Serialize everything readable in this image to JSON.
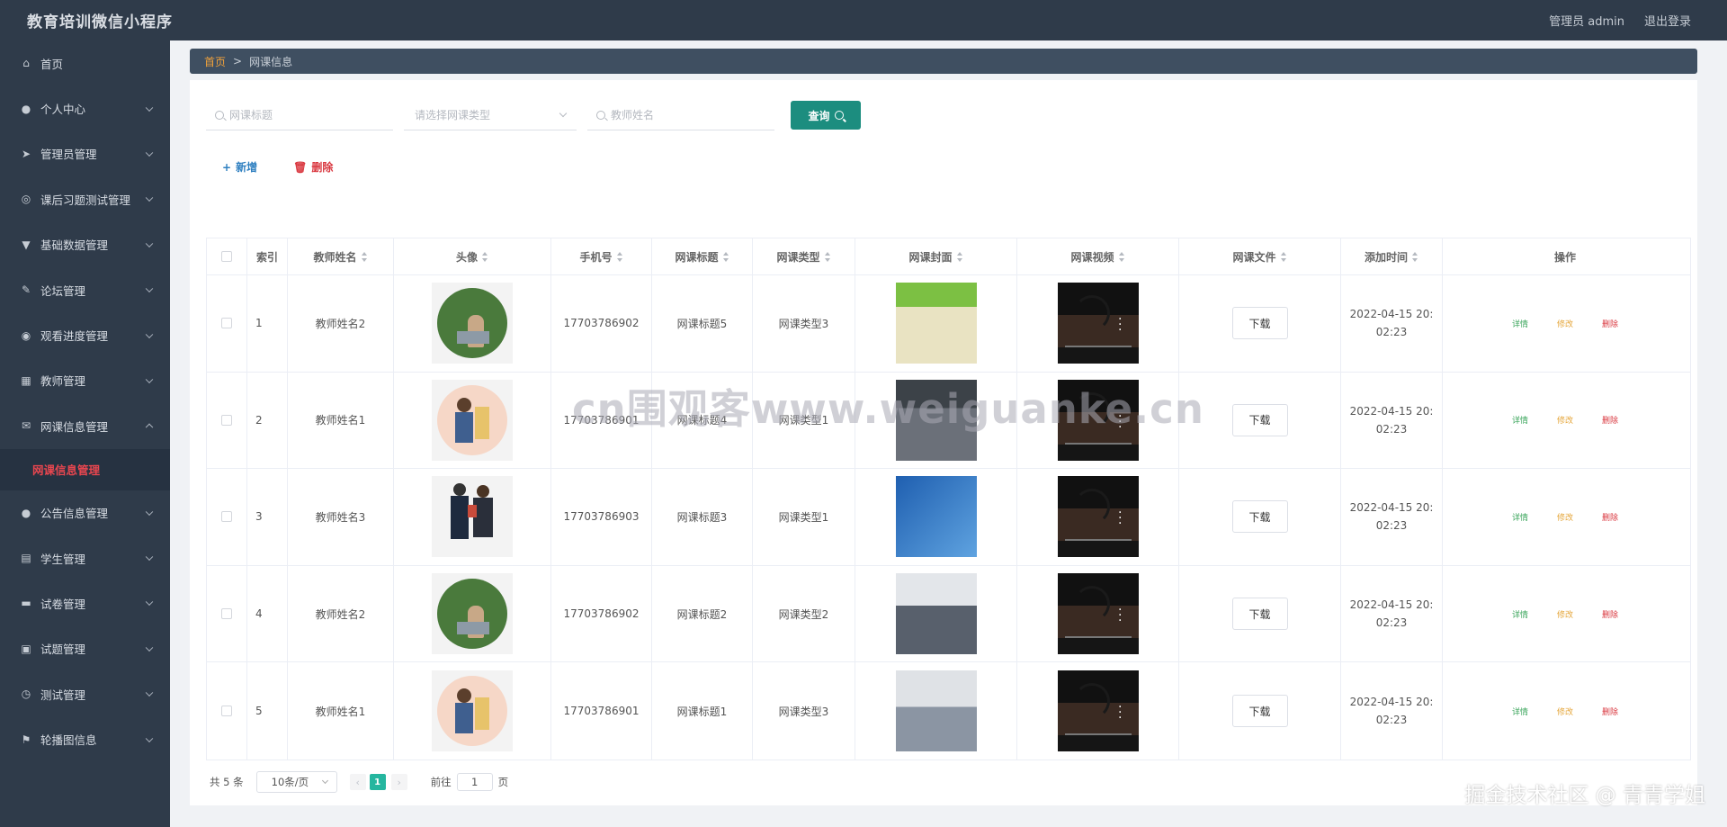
{
  "header": {
    "app_title": "教育培训微信小程序",
    "user_label": "管理员 admin",
    "logout_label": "退出登录"
  },
  "sidebar": {
    "items": [
      {
        "label": "首页",
        "icon": "home-icon"
      },
      {
        "label": "个人中心",
        "icon": "user-icon"
      },
      {
        "label": "管理员管理",
        "icon": "send-icon"
      },
      {
        "label": "课后习题测试管理",
        "icon": "compass-icon"
      },
      {
        "label": "基础数据管理",
        "icon": "pin-icon"
      },
      {
        "label": "论坛管理",
        "icon": "edit-icon"
      },
      {
        "label": "观看进度管理",
        "icon": "target-icon"
      },
      {
        "label": "教师管理",
        "icon": "grid-icon"
      },
      {
        "label": "网课信息管理",
        "icon": "mail-icon"
      },
      {
        "label": "公告信息管理",
        "icon": "user-icon"
      },
      {
        "label": "学生管理",
        "icon": "doc-icon"
      },
      {
        "label": "试卷管理",
        "icon": "print-icon"
      },
      {
        "label": "试题管理",
        "icon": "clipboard-icon"
      },
      {
        "label": "测试管理",
        "icon": "clock-icon"
      },
      {
        "label": "轮播图信息",
        "icon": "flag-icon"
      }
    ],
    "active_sub": "网课信息管理"
  },
  "breadcrumb": {
    "home": "首页",
    "sep": ">",
    "current": "网课信息"
  },
  "search": {
    "title_placeholder": "网课标题",
    "type_placeholder": "请选择网课类型",
    "teacher_placeholder": "教师姓名",
    "query_label": "查询"
  },
  "actions": {
    "add_label": "新增",
    "delete_label": "删除"
  },
  "table": {
    "headers": [
      "索引",
      "教师姓名",
      "头像",
      "手机号",
      "网课标题",
      "网课类型",
      "网课封面",
      "网课视频",
      "网课文件",
      "添加时间",
      "操作"
    ],
    "download_label": "下载",
    "op_detail": "详情",
    "op_edit": "修改",
    "op_delete": "删除",
    "rows": [
      {
        "index": "1",
        "teacher": "教师姓名2",
        "phone": "17703786902",
        "title": "网课标题5",
        "type": "网课类型3",
        "time": "2022-04-15 20:02:23"
      },
      {
        "index": "2",
        "teacher": "教师姓名1",
        "phone": "17703786901",
        "title": "网课标题4",
        "type": "网课类型1",
        "time": "2022-04-15 20:02:23"
      },
      {
        "index": "3",
        "teacher": "教师姓名3",
        "phone": "17703786903",
        "title": "网课标题3",
        "type": "网课类型1",
        "time": "2022-04-15 20:02:23"
      },
      {
        "index": "4",
        "teacher": "教师姓名2",
        "phone": "17703786902",
        "title": "网课标题2",
        "type": "网课类型2",
        "time": "2022-04-15 20:02:23"
      },
      {
        "index": "5",
        "teacher": "教师姓名1",
        "phone": "17703786901",
        "title": "网课标题1",
        "type": "网课类型3",
        "time": "2022-04-15 20:02:23"
      }
    ]
  },
  "pager": {
    "total": "共 5 条",
    "page_size": "10条/页",
    "current": "1",
    "goto_prefix": "前往",
    "goto_value": "1",
    "goto_suffix": "页"
  },
  "watermark": "cn围观客www.weiguanke.cn",
  "credit": "掘金技术社区 @ 青青学姐"
}
